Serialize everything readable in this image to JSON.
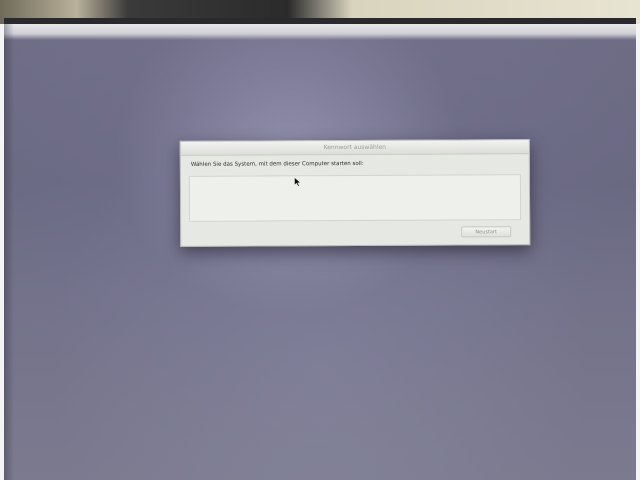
{
  "dialog": {
    "title": "Kennwort auswählen",
    "message": "Wählen Sie das System, mit dem dieser Computer starten soll:",
    "button_label": "Neustart"
  },
  "icons": {
    "cursor": "mouse-pointer-icon"
  },
  "colors": {
    "desktop_background": "#6f6d86",
    "dialog_background": "#e6e8e4"
  }
}
